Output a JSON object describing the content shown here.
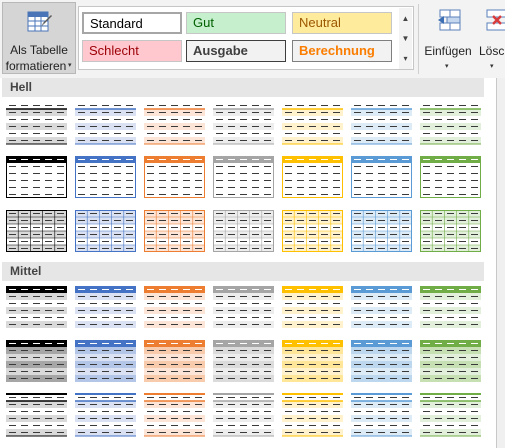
{
  "ribbon": {
    "format_as_table_line1": "Als Tabelle",
    "format_as_table_line2": "formatieren",
    "insert_label": "Einfügen",
    "delete_label": "Lösch"
  },
  "cell_styles": [
    {
      "label": "Standard",
      "bg": "#ffffff",
      "fg": "#000000",
      "bold": false,
      "selected": true
    },
    {
      "label": "Gut",
      "bg": "#c6efce",
      "fg": "#006100",
      "bold": false
    },
    {
      "label": "Neutral",
      "bg": "#ffeb9c",
      "fg": "#9c5700",
      "bold": false
    },
    {
      "label": "Schlecht",
      "bg": "#ffc7ce",
      "fg": "#9c0006",
      "bold": false
    },
    {
      "label": "Ausgabe",
      "bg": "#f2f2f2",
      "fg": "#3f3f3f",
      "bold": true
    },
    {
      "label": "Berechnung",
      "bg": "#f2f2f2",
      "fg": "#fa7d00",
      "bold": true
    }
  ],
  "gallery": {
    "sections": [
      {
        "title": "Hell"
      },
      {
        "title": "Mittel"
      }
    ],
    "accent_colors": [
      "#000000",
      "#4472c4",
      "#ed7d31",
      "#a5a5a5",
      "#ffc000",
      "#5b9bd5",
      "#70ad47"
    ],
    "light_tints": [
      "#d9d9d9",
      "#d9e1f2",
      "#fce4d6",
      "#ededed",
      "#fff2cc",
      "#ddebf7",
      "#e2efda"
    ],
    "medium_tints": [
      "#bfbfbf",
      "#b4c6e7",
      "#f8cbad",
      "#dbdbdb",
      "#ffe699",
      "#bdd7ee",
      "#c6e0b4"
    ]
  }
}
